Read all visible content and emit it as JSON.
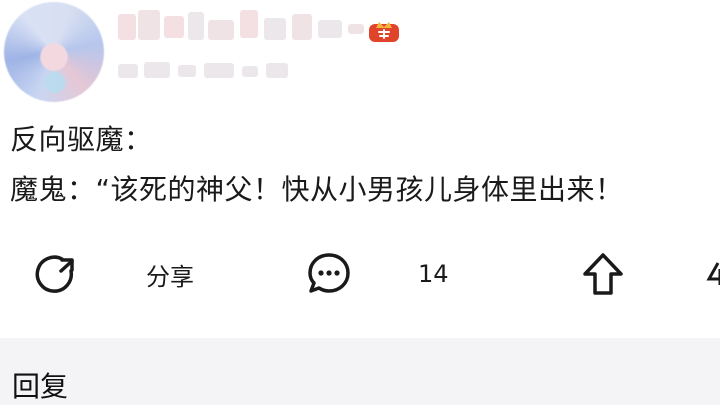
{
  "post": {
    "line1": "反向驱魔：",
    "line2": "魔鬼：“该死的神父！快从小男孩儿身体里出来！"
  },
  "actions": {
    "share_label": "分享",
    "comment_count": "14"
  },
  "reply": {
    "label": "回复"
  },
  "icons": {
    "repost": "repost-icon",
    "comment": "comment-bubble-icon",
    "upvote": "upvote-arrow-icon",
    "badge": "crown-badge-icon"
  },
  "colors": {
    "badge_red": "#e0452b",
    "badge_gold": "#f3b53b",
    "text": "#1a1a1a",
    "reply_bg": "#f4f4f6"
  }
}
